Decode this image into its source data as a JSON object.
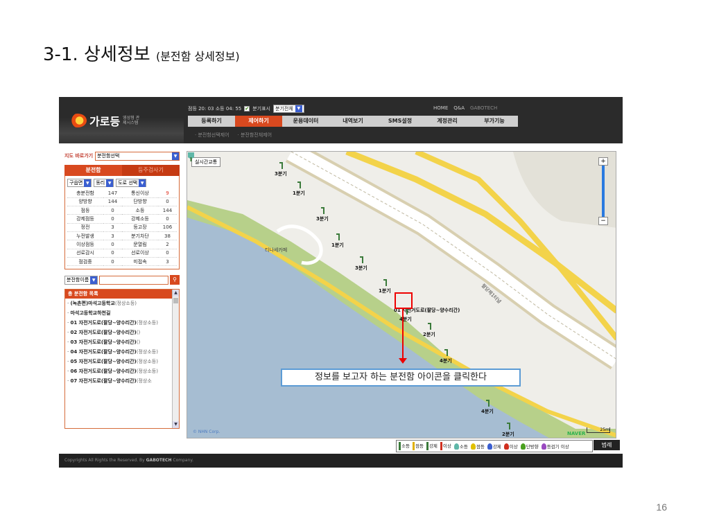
{
  "slide": {
    "title": "3-1. 상세정보",
    "subtitle": "(분전함 상세정보)",
    "page_number": "16"
  },
  "header": {
    "logo_name": "가로등",
    "logo_sub": "영상형 관제시스템",
    "status_text": "점등 20: 03 소등 04: 55",
    "show_label": "분기표시",
    "branch_select": "분기전체",
    "links": [
      "HOME",
      "Q&A",
      "GABOTECH"
    ],
    "menu": [
      "등록하기",
      "제어하기",
      "운용데이터",
      "내역보기",
      "SMS설정",
      "계정관리",
      "부가기능"
    ],
    "submenu": [
      "· 분전함선택제어",
      "· 분전함전체제어"
    ]
  },
  "left": {
    "quick_label": "지도 바로가기",
    "quick_select": "분전함선택",
    "tabs": [
      "분전함",
      "등주검사기"
    ],
    "filters": [
      "구읍면",
      "동리",
      "도로 선택"
    ],
    "stats": [
      [
        "총분전함",
        "147",
        "통신이상",
        "9"
      ],
      [
        "양방향",
        "144",
        "단방향",
        "0"
      ],
      [
        "점등",
        "0",
        "소등",
        "144"
      ],
      [
        "강제점등",
        "0",
        "강제소등",
        "0"
      ],
      [
        "정전",
        "3",
        "등고장",
        "106"
      ],
      [
        "누전발생",
        "3",
        "분기차단",
        "38"
      ],
      [
        "이상점등",
        "0",
        "문열림",
        "2"
      ],
      [
        "선로감시",
        "0",
        "선로이상",
        "0"
      ],
      [
        "점검중",
        "0",
        "미접속",
        "3"
      ]
    ],
    "search_select": "분전함이름",
    "list_header": "총 분전함 목록",
    "list": [
      {
        "name": "(녹촌편)마석고등학교",
        "status": "(정상소등)"
      },
      {
        "name": "마석고등학교하천길",
        "status": ""
      },
      {
        "name": "01 자전거도로(팔당~양수리간)",
        "status": "(정상소등)"
      },
      {
        "name": "02 자전거도로(팔당~양수리간)",
        "status": "()"
      },
      {
        "name": "03 자전거도로(팔당~양수리간)",
        "status": "()"
      },
      {
        "name": "04 자전거도로(팔당~양수리간)",
        "status": "(정상소등)"
      },
      {
        "name": "05 자전거도로(팔당~양수리간)",
        "status": "(정상소등)"
      },
      {
        "name": "06 자전거도로(팔당~양수리간)",
        "status": "(정상소등)"
      },
      {
        "name": "07 자전거도로(팔당~양수리간)",
        "status": "(정상소"
      }
    ]
  },
  "map": {
    "realtime_label": "실시간교통",
    "labels": {
      "b3a": "3분기",
      "b1a": "1분기",
      "b3b": "3분기",
      "b1b": "1분기",
      "b3c": "3분기",
      "b1c": "1분기",
      "cafe": "티나세카페",
      "box": "01 자전거도로(팔당~양수리간)",
      "b4a": "4분기",
      "b2a": "2분기",
      "b4b": "4분기",
      "b4c": "4분기",
      "b2b": "2분기",
      "road": "팔당제1터널"
    },
    "callout": "정보를 보고자 하는 분전함 아이콘을 클릭한다",
    "nhn": "© NHN Corp.",
    "naver": "NAVER",
    "scale": "25m"
  },
  "legend": {
    "items": [
      "소등",
      "점등",
      "강제",
      "이상",
      "소등",
      "점등",
      "강제",
      "이상",
      "단방향",
      "등검기 이상"
    ],
    "button": "범례"
  },
  "footer": {
    "text": "Copyrights All Rights the Reserved. By",
    "brand": "GABOTECH",
    "text2": "Company."
  },
  "colors": {
    "accent": "#d8491f",
    "water": "#a6bdd2",
    "road": "#f3d34a",
    "grass": "#b7d08a"
  }
}
